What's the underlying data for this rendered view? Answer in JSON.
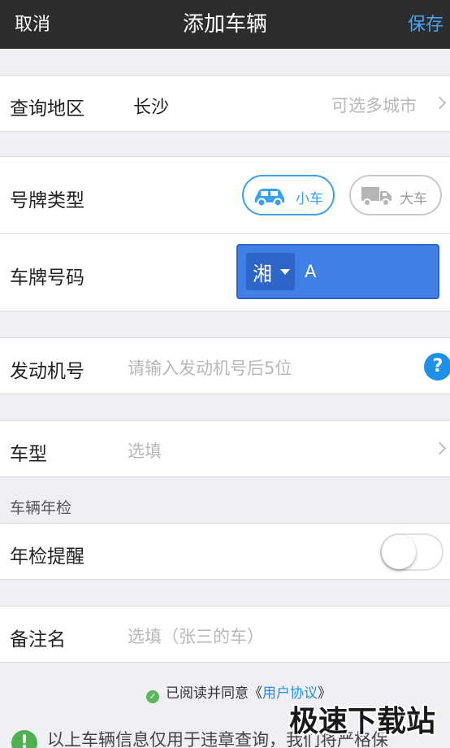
{
  "navbar": {
    "cancel": "取消",
    "title": "添加车辆",
    "save": "保存"
  },
  "region": {
    "label": "查询地区",
    "value": "长沙",
    "hint": "可选多城市"
  },
  "plate_type": {
    "label": "号牌类型",
    "options": [
      {
        "label": "小车",
        "selected": true
      },
      {
        "label": "大车",
        "selected": false
      }
    ]
  },
  "plate_number": {
    "label": "车牌号码",
    "province": "湘",
    "value": "A"
  },
  "engine": {
    "label": "发动机号",
    "placeholder": "请输入发动机号后5位",
    "help": "?"
  },
  "model": {
    "label": "车型",
    "placeholder": "选填"
  },
  "inspection": {
    "section_title": "车辆年检",
    "reminder_label": "年检提醒",
    "reminder_on": false
  },
  "remark": {
    "label": "备注名",
    "placeholder": "选填（张三的车）"
  },
  "agreement": {
    "prefix": "已阅读并同意《",
    "link": "用户协议",
    "suffix": "》"
  },
  "notice": {
    "text": "以上车辆信息仅用于违章查询，我们将严格保"
  },
  "watermark": "极速下载站",
  "colors": {
    "accent": "#1e90e8",
    "navbar": "#2d2d2d",
    "plate": "#3f7fe6"
  }
}
